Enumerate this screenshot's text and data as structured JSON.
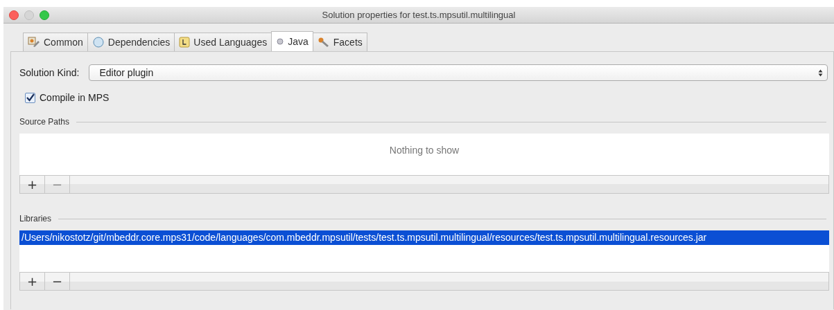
{
  "window": {
    "title": "Solution properties for test.ts.mpsutil.multilingual"
  },
  "tabs": [
    {
      "label": "Common",
      "selected": false
    },
    {
      "label": "Dependencies",
      "selected": false
    },
    {
      "label": "Used Languages",
      "selected": false
    },
    {
      "label": "Java",
      "selected": true
    },
    {
      "label": "Facets",
      "selected": false
    }
  ],
  "solution_kind": {
    "label": "Solution Kind:",
    "value": "Editor plugin"
  },
  "compile_in_mps": {
    "label": "Compile in MPS",
    "checked": true
  },
  "source_paths": {
    "title": "Source Paths",
    "empty_text": "Nothing to show",
    "toolbar": [
      {
        "label": "+",
        "disabled": false
      },
      {
        "label": "−",
        "disabled": true
      }
    ]
  },
  "libraries": {
    "title": "Libraries",
    "rows": [
      {
        "text": "/Users/nikostotz/git/mbeddr.core.mps31/code/languages/com.mbeddr.mpsutil/tests/test.ts.mpsutil.multilingual/resources/test.ts.mpsutil.multilingual.resources.jar",
        "selected": true
      }
    ],
    "toolbar": [
      {
        "label": "+",
        "disabled": false
      },
      {
        "label": "−",
        "disabled": false
      }
    ]
  }
}
